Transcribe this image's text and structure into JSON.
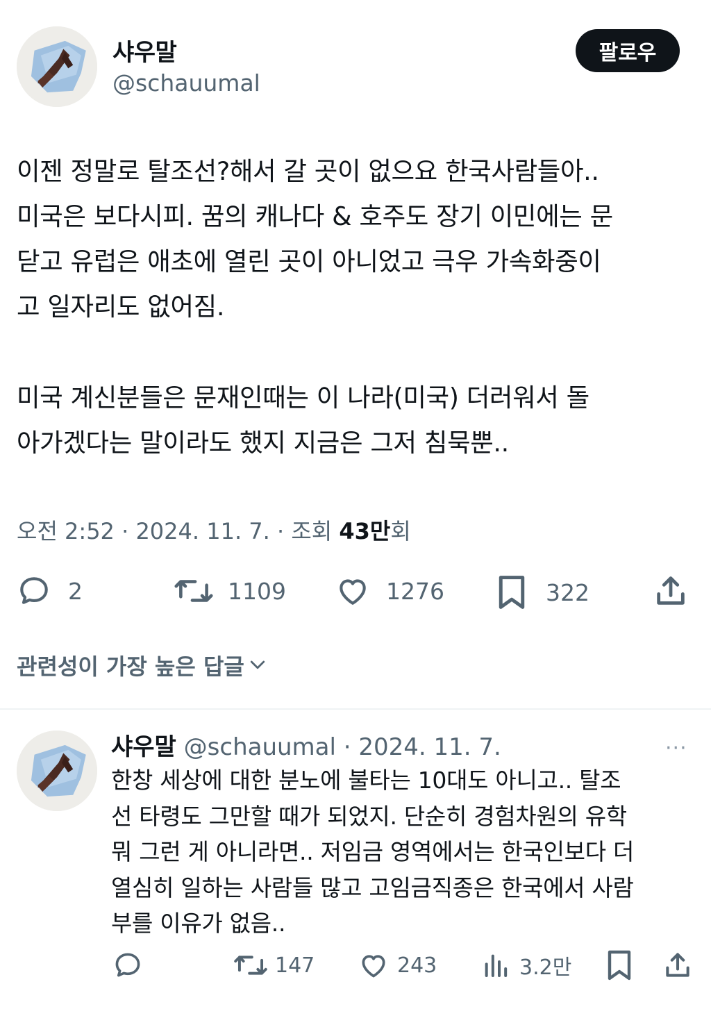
{
  "tweet": {
    "author_name": "샤우말",
    "author_handle": "@schauumal",
    "follow_label": "팔로우",
    "lines": [
      "이젠 정말로 탈조선?해서 갈 곳이 없으요 한국사람들아..",
      "미국은 보다시피. 꿈의 캐나다 & 호주도 장기 이민에는 문",
      "닫고 유럽은 애초에 열린 곳이 아니었고 극우 가속화중이",
      "고 일자리도 없어짐.",
      "미국 계신분들은 문재인때는 이 나라(미국) 더러워서 돌",
      "아가겠다는 말이라도 했지 지금은 그저 침묵뿐.."
    ],
    "time": "오전 2:52",
    "date": "2024. 11. 7.",
    "views_label": "조회",
    "views_count": "43만",
    "views_suffix": "회",
    "stats": {
      "replies": "2",
      "retweets": "1109",
      "likes": "1276",
      "bookmarks": "322"
    }
  },
  "sort_label": "관련성이 가장 높은 답글",
  "reply": {
    "author_name": "샤우말",
    "author_handle": "@schauumal",
    "date": "2024. 11. 7.",
    "more": "···",
    "lines": [
      "한창 세상에 대한 분노에 불타는 10대도 아니고.. 탈조",
      "선 타령도 그만할 때가 되었지. 단순히 경험차원의 유학",
      "뭐 그런 게 아니라면.. 저임금 영역에서는 한국인보다 더",
      "열심히 일하는 사람들 많고 고임금직종은 한국에서 사람",
      "부를 이유가 없음.."
    ],
    "stats": {
      "retweets": "147",
      "likes": "243",
      "views": "3.2만"
    }
  },
  "colors": {
    "text": "#0f1419",
    "secondary": "#536471",
    "button_bg": "#0f1419"
  }
}
